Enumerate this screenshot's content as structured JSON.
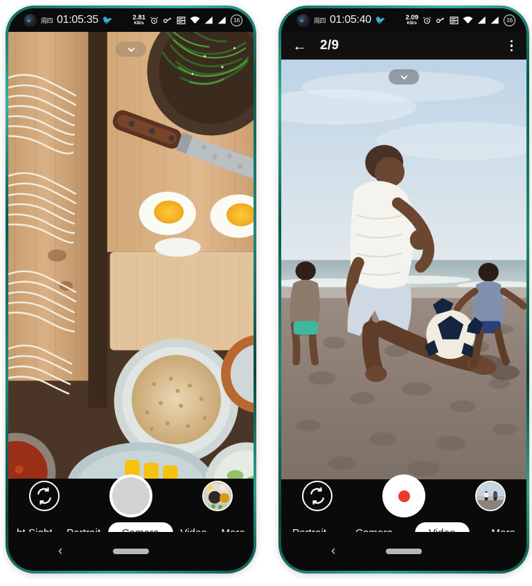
{
  "scene": {
    "description": "Two Android smartphones side by side showing a camera app in photo mode and video mode",
    "background_color": "#ffffff",
    "frame_color": "#0f6b5b"
  },
  "phones": [
    {
      "id": "left",
      "status_bar": {
        "weekday": "周四",
        "time": "01:05:35",
        "emoji": "🐦",
        "net_speed_value": "2.81",
        "net_speed_unit": "KB/s",
        "alarm_icon": "alarm-icon",
        "key_icon": "key-icon",
        "box_icon": "vpn-box-icon",
        "wifi_icon": "wifi-icon",
        "signal1_icon": "signal-icon",
        "signal2_icon": "signal-icon",
        "battery_level": "16"
      },
      "has_gallery_header": false,
      "viewfinder": {
        "subject": "overhead-food-flatlay-noodles-eggs-spinach",
        "chevron_icon": "chevron-down-icon",
        "chevron_style": "bare"
      },
      "controls": {
        "flip_icon": "camera-flip-icon",
        "shutter_type": "photo",
        "shutter_label": "shutter-button",
        "thumbnail_label": "last-photo-thumbnail"
      },
      "mode_bar": {
        "modes": [
          {
            "label": "ht Sight",
            "active": false
          },
          {
            "label": "Portrait",
            "active": false
          },
          {
            "label": "Camera",
            "active": true
          },
          {
            "label": "Video",
            "active": false
          },
          {
            "label": "More",
            "active": false
          }
        ]
      },
      "nav_bar": {
        "back_icon": "back-chevron-icon",
        "home_icon": "home-pill-indicator"
      }
    },
    {
      "id": "right",
      "status_bar": {
        "weekday": "周四",
        "time": "01:05:40",
        "emoji": "🐦",
        "net_speed_value": "2.09",
        "net_speed_unit": "KB/s",
        "alarm_icon": "alarm-icon",
        "key_icon": "key-icon",
        "box_icon": "vpn-box-icon",
        "wifi_icon": "wifi-icon",
        "signal1_icon": "signal-icon",
        "signal2_icon": "signal-icon",
        "battery_level": "16"
      },
      "has_gallery_header": true,
      "gallery_header": {
        "back_icon": "back-arrow-icon",
        "title": "2/9",
        "menu_icon": "overflow-menu-icon"
      },
      "viewfinder": {
        "subject": "beach-football-players-sand-sky",
        "chevron_icon": "chevron-down-icon",
        "chevron_style": "pill"
      },
      "controls": {
        "flip_icon": "camera-flip-icon",
        "shutter_type": "video",
        "shutter_label": "record-button",
        "thumbnail_label": "last-video-thumbnail"
      },
      "mode_bar": {
        "modes": [
          {
            "label": "Portrait",
            "active": false
          },
          {
            "label": "Camera",
            "active": false
          },
          {
            "label": "Video",
            "active": true
          },
          {
            "label": "More",
            "active": false
          }
        ]
      },
      "nav_bar": {
        "back_icon": "back-chevron-icon",
        "home_icon": "home-pill-indicator"
      }
    }
  ]
}
